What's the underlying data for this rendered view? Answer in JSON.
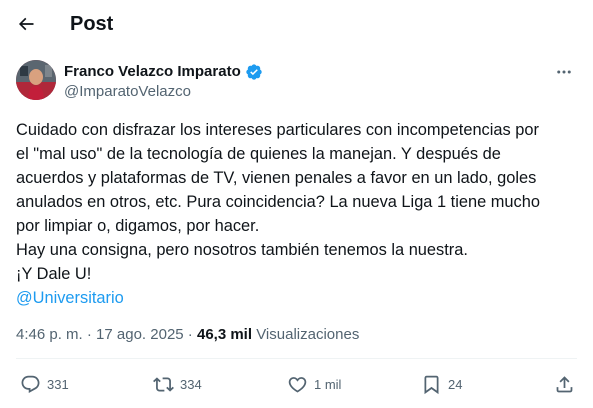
{
  "header": {
    "title": "Post",
    "back_icon": "arrow-left-icon"
  },
  "author": {
    "name": "Franco Velazco Imparato",
    "handle": "@ImparatoVelazco",
    "verified_color": "#1d9bf0",
    "more_icon": "more-horizontal-icon"
  },
  "tweet": {
    "lines": [
      "Cuidado con disfrazar los intereses particulares con incompetencias por",
      "el \"mal uso\" de la tecnología de quienes la manejan. Y después de",
      "acuerdos y plataformas de TV, vienen penales a favor en un lado, goles",
      "anulados en otros, etc. Pura coincidencia?  La nueva Liga 1 tiene mucho",
      "por limpiar o, digamos, por hacer.",
      "Hay una consigna, pero nosotros también tenemos la nuestra.",
      "¡Y Dale U!"
    ],
    "mention": "@Universitario"
  },
  "meta": {
    "time": "4:46 p. m.",
    "separator": " · ",
    "date": "17 ago. 2025",
    "separator2": " · ",
    "views_count": "46,3 mil",
    "views_label": " Visualizaciones"
  },
  "actions": {
    "replies": "331",
    "reposts": "334",
    "likes": "1 mil",
    "bookmarks": "24",
    "colors": {
      "icon": "#536471",
      "accent": "#1d9bf0"
    }
  }
}
